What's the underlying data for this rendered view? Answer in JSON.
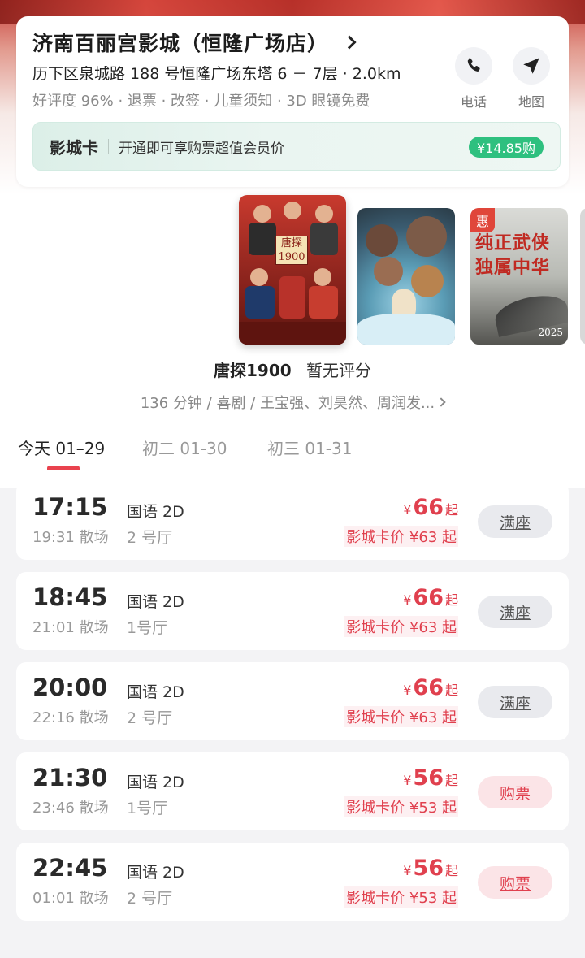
{
  "cinema": {
    "name": "济南百丽宫影城（恒隆广场店）",
    "address": "历下区泉城路 188 号恒隆广场东塔 6 － 7层 · 2.0km",
    "tags": "好评度 96% · 退票 · 改签 · 儿童须知 · 3D 眼镜免费",
    "phone_label": "电话",
    "map_label": "地图"
  },
  "member_card": {
    "title": "影城卡",
    "description": "开通即可享购票超值会员价",
    "price_button": "¥14.85购"
  },
  "posters": [
    {
      "title_text": "唐探1900",
      "selected": true
    },
    {
      "title_text": "",
      "selected": false
    },
    {
      "badge": "惠",
      "cap_line1": "纯正武侠",
      "cap_line2": "独属中华",
      "year": "2025",
      "selected": false
    }
  ],
  "movie": {
    "name": "唐探1900",
    "rating": "暂无评分",
    "meta": "136 分钟 / 喜剧 / 王宝强、刘昊然、周润发..."
  },
  "date_tabs": [
    {
      "label": "今天 01–29",
      "active": true
    },
    {
      "label": "初二  01-30",
      "active": false
    },
    {
      "label": "初三  01-31",
      "active": false
    }
  ],
  "showtimes": [
    {
      "start": "17:15",
      "end": "19:31 散场",
      "language": "国语 2D",
      "hall": "2 号厅",
      "currency": "¥",
      "price": "66",
      "suffix": "起",
      "card_price": "影城卡价 ¥63 起",
      "button": "满座",
      "status": "full"
    },
    {
      "start": "18:45",
      "end": "21:01 散场",
      "language": "国语 2D",
      "hall": "1号厅",
      "currency": "¥",
      "price": "66",
      "suffix": "起",
      "card_price": "影城卡价 ¥63 起",
      "button": "满座",
      "status": "full"
    },
    {
      "start": "20:00",
      "end": "22:16 散场",
      "language": "国语 2D",
      "hall": "2 号厅",
      "currency": "¥",
      "price": "66",
      "suffix": "起",
      "card_price": "影城卡价 ¥63 起",
      "button": "满座",
      "status": "full"
    },
    {
      "start": "21:30",
      "end": "23:46 散场",
      "language": "国语 2D",
      "hall": "1号厅",
      "currency": "¥",
      "price": "56",
      "suffix": "起",
      "card_price": "影城卡价 ¥53 起",
      "button": "购票",
      "status": "buy"
    },
    {
      "start": "22:45",
      "end": "01:01 散场",
      "language": "国语 2D",
      "hall": "2 号厅",
      "currency": "¥",
      "price": "56",
      "suffix": "起",
      "card_price": "影城卡价 ¥53 起",
      "button": "购票",
      "status": "buy"
    }
  ],
  "colors": {
    "accent_red": "#e0404e",
    "member_green": "#2ec07f"
  }
}
